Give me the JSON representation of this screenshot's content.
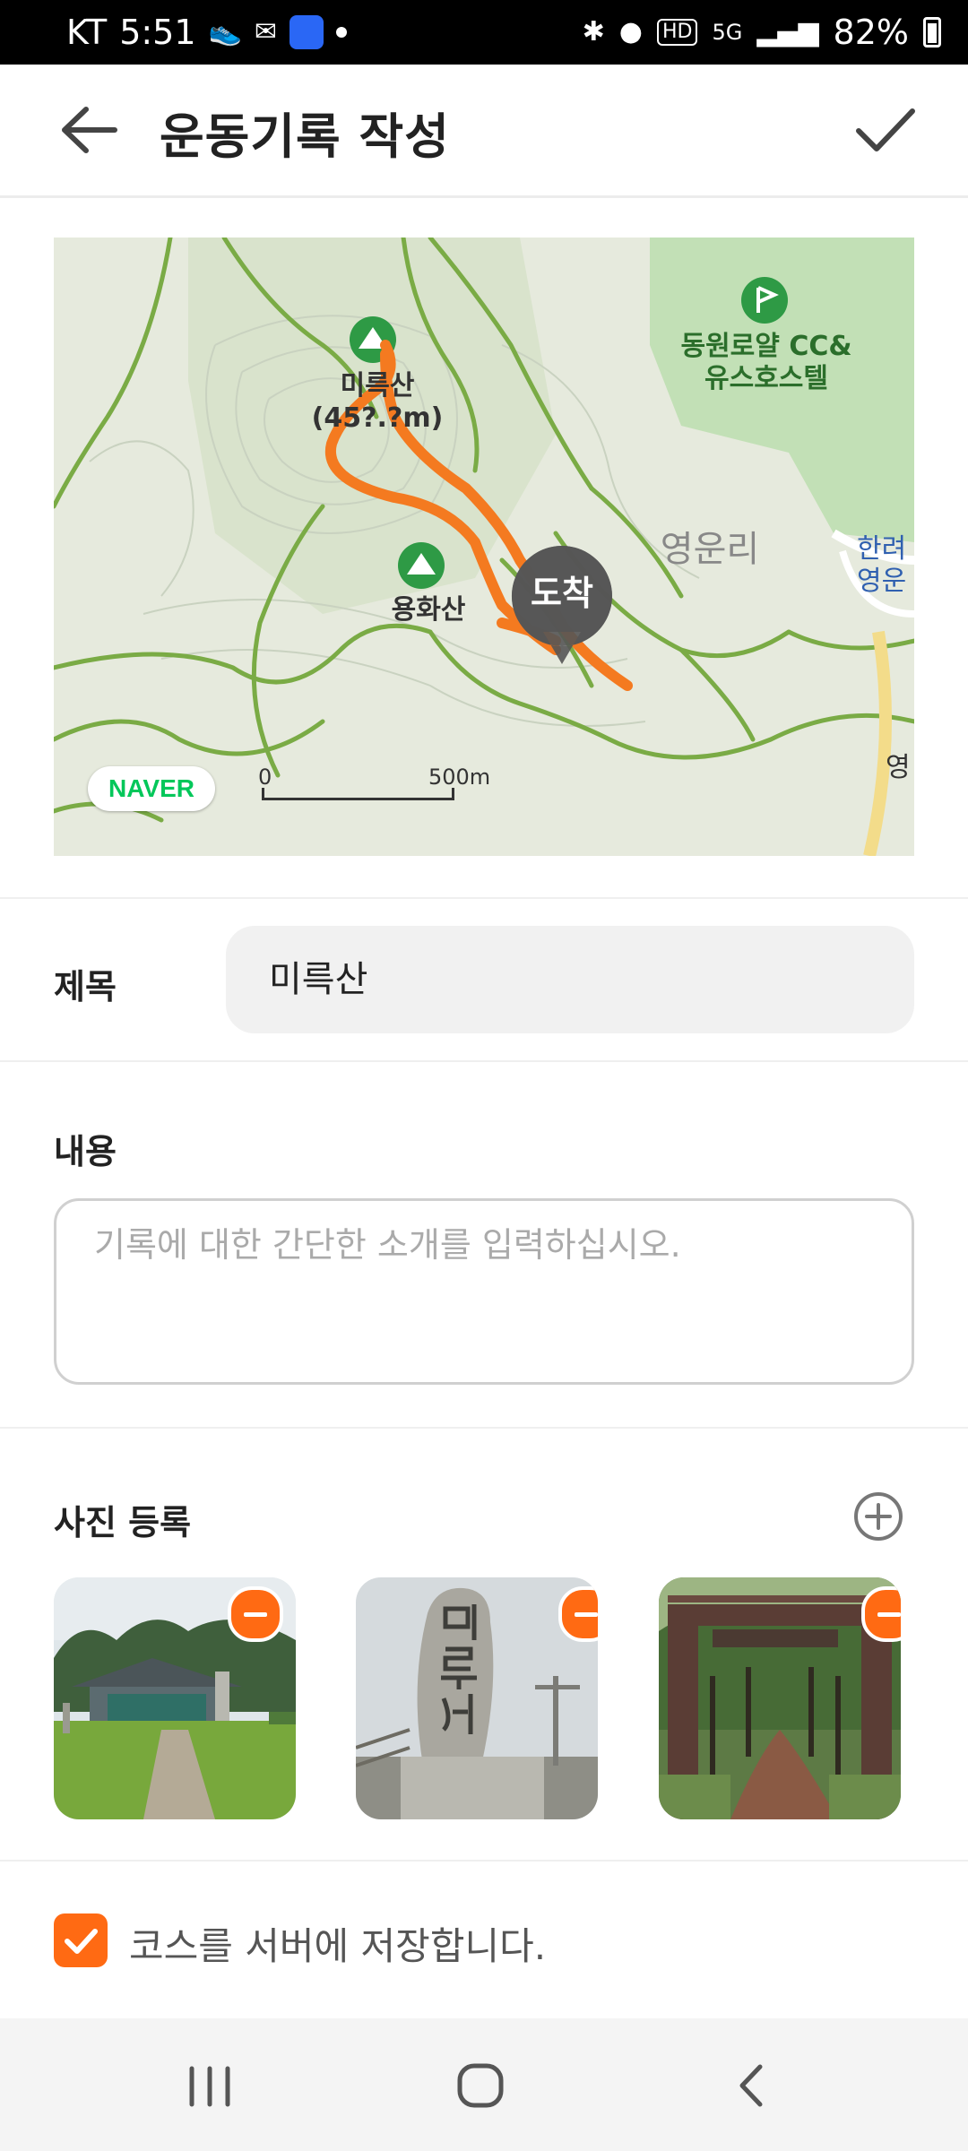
{
  "status_bar": {
    "carrier": "KT",
    "time": "5:51",
    "network": "5G",
    "battery": "82%"
  },
  "app_bar": {
    "title": "운동기록 작성"
  },
  "map": {
    "provider": "NAVER",
    "scale_start": "0",
    "scale_end": "500m",
    "labels": {
      "peak_name": "미륵산",
      "peak_height": "(45?.?m)",
      "mountain2": "용화산",
      "golf_line1": "동원로얄 CC&",
      "golf_line2": "유스호스텔",
      "village": "영운리",
      "edge_line1": "한려",
      "edge_line2": "영운",
      "edge_small": "영"
    },
    "arrival_marker": "도착"
  },
  "form": {
    "title_label": "제목",
    "title_value": "미륵산",
    "content_label": "내용",
    "content_placeholder": "기록에 대한 간단한 소개를 입력하십시오."
  },
  "photos": {
    "section_label": "사진 등록",
    "items": [
      "temple-photo",
      "stone-monument-photo",
      "trail-gate-photo"
    ]
  },
  "save_course": {
    "label": "코스를 서버에 저장합니다.",
    "checked": true
  },
  "colors": {
    "accent": "#ff6a13",
    "route": "#f47a20",
    "naver_green": "#03c75a"
  }
}
